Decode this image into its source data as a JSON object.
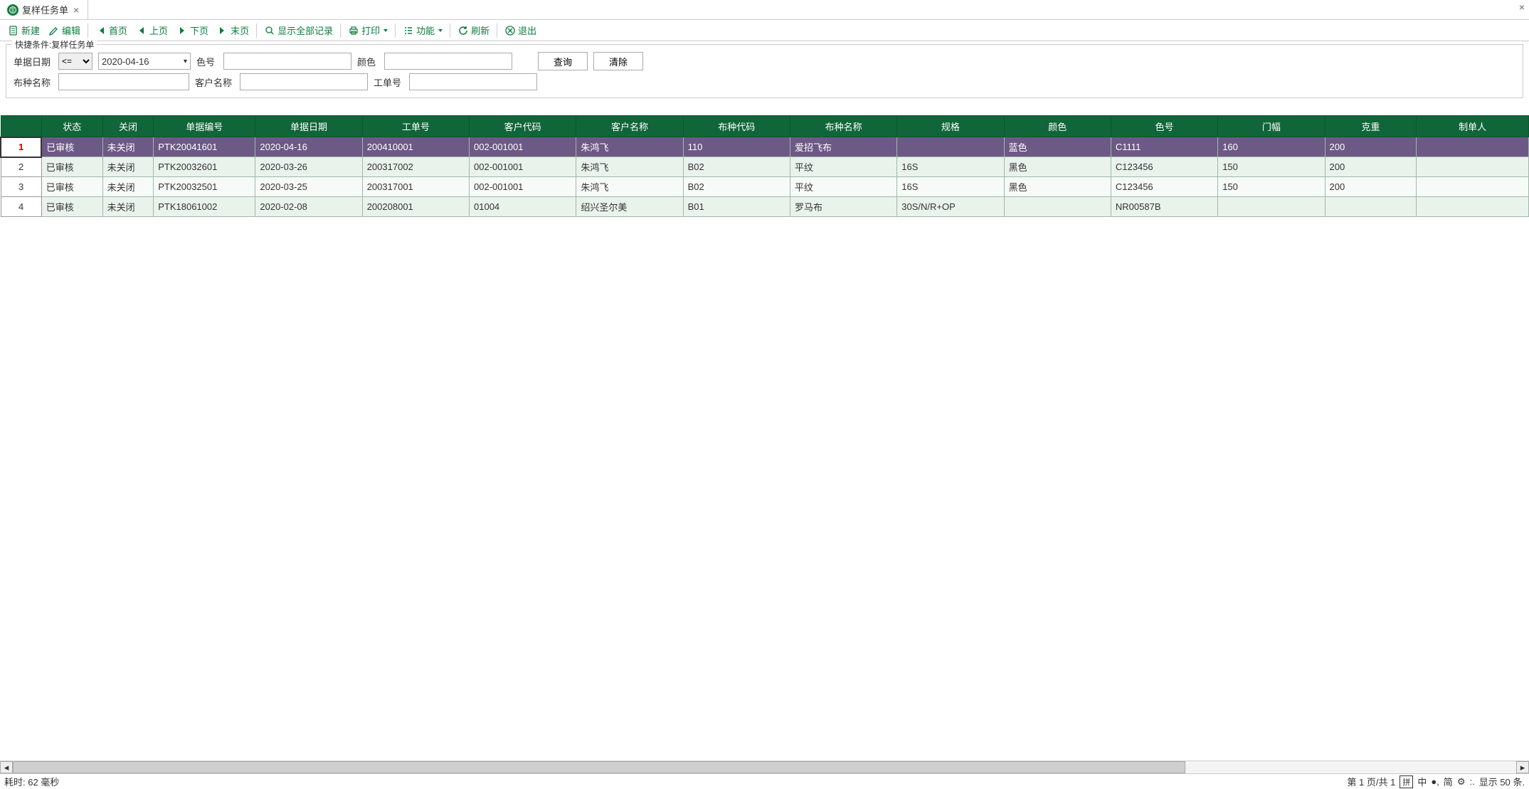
{
  "tab": {
    "title": "复样任务单"
  },
  "toolbar": {
    "new": "新建",
    "edit": "编辑",
    "first": "首页",
    "prev": "上页",
    "next": "下页",
    "last": "末页",
    "showall": "显示全部记录",
    "print": "打印",
    "func": "功能",
    "refresh": "刷新",
    "exit": "退出"
  },
  "filter": {
    "legend": "快捷条件:复样任务单",
    "labels": {
      "billDate": "单据日期",
      "colorNo": "色号",
      "color": "颜色",
      "fabricName": "布种名称",
      "custName": "客户名称",
      "workOrder": "工单号"
    },
    "operator": "<=",
    "dateValue": "2020-04-16",
    "btnQuery": "查询",
    "btnClear": "清除"
  },
  "columns": {
    "status": "状态",
    "closed": "关闭",
    "billNo": "单据编号",
    "billDate": "单据日期",
    "workOrder": "工单号",
    "custCode": "客户代码",
    "custName": "客户名称",
    "fabricCode": "布种代码",
    "fabricName": "布种名称",
    "spec": "规格",
    "color": "颜色",
    "colorNo": "色号",
    "width": "门幅",
    "weight": "克重",
    "creator": "制单人"
  },
  "rows": [
    {
      "n": "1",
      "status": "已审核",
      "closed": "未关闭",
      "billNo": "PTK20041601",
      "billDate": "2020-04-16",
      "workOrder": "200410001",
      "custCode": "002-001001",
      "custName": "朱鸿飞",
      "fabricCode": "110",
      "fabricName": "爱招飞布",
      "spec": "",
      "color": "蓝色",
      "colorNo": "C1111",
      "width": "160",
      "weight": "200",
      "creator": ""
    },
    {
      "n": "2",
      "status": "已审核",
      "closed": "未关闭",
      "billNo": "PTK20032601",
      "billDate": "2020-03-26",
      "workOrder": "200317002",
      "custCode": "002-001001",
      "custName": "朱鸿飞",
      "fabricCode": "B02",
      "fabricName": "平纹",
      "spec": "16S",
      "color": "黑色",
      "colorNo": "C123456",
      "width": "150",
      "weight": "200",
      "creator": ""
    },
    {
      "n": "3",
      "status": "已审核",
      "closed": "未关闭",
      "billNo": "PTK20032501",
      "billDate": "2020-03-25",
      "workOrder": "200317001",
      "custCode": "002-001001",
      "custName": "朱鸿飞",
      "fabricCode": "B02",
      "fabricName": "平纹",
      "spec": "16S",
      "color": "黑色",
      "colorNo": "C123456",
      "width": "150",
      "weight": "200",
      "creator": ""
    },
    {
      "n": "4",
      "status": "已审核",
      "closed": "未关闭",
      "billNo": "PTK18061002",
      "billDate": "2020-02-08",
      "workOrder": "200208001",
      "custCode": "01004",
      "custName": "绍兴圣尔美",
      "fabricCode": "B01",
      "fabricName": "罗马布",
      "spec": "30S/N/R+OP",
      "color": "",
      "colorNo": "NR00587B",
      "width": "",
      "weight": "",
      "creator": ""
    }
  ],
  "status": {
    "timing": "耗时: 62 毫秒",
    "page": "第 1 页/共 1",
    "ime1": "拼",
    "ime2": "中",
    "ime3": "简",
    "display": "显示 50 条."
  }
}
